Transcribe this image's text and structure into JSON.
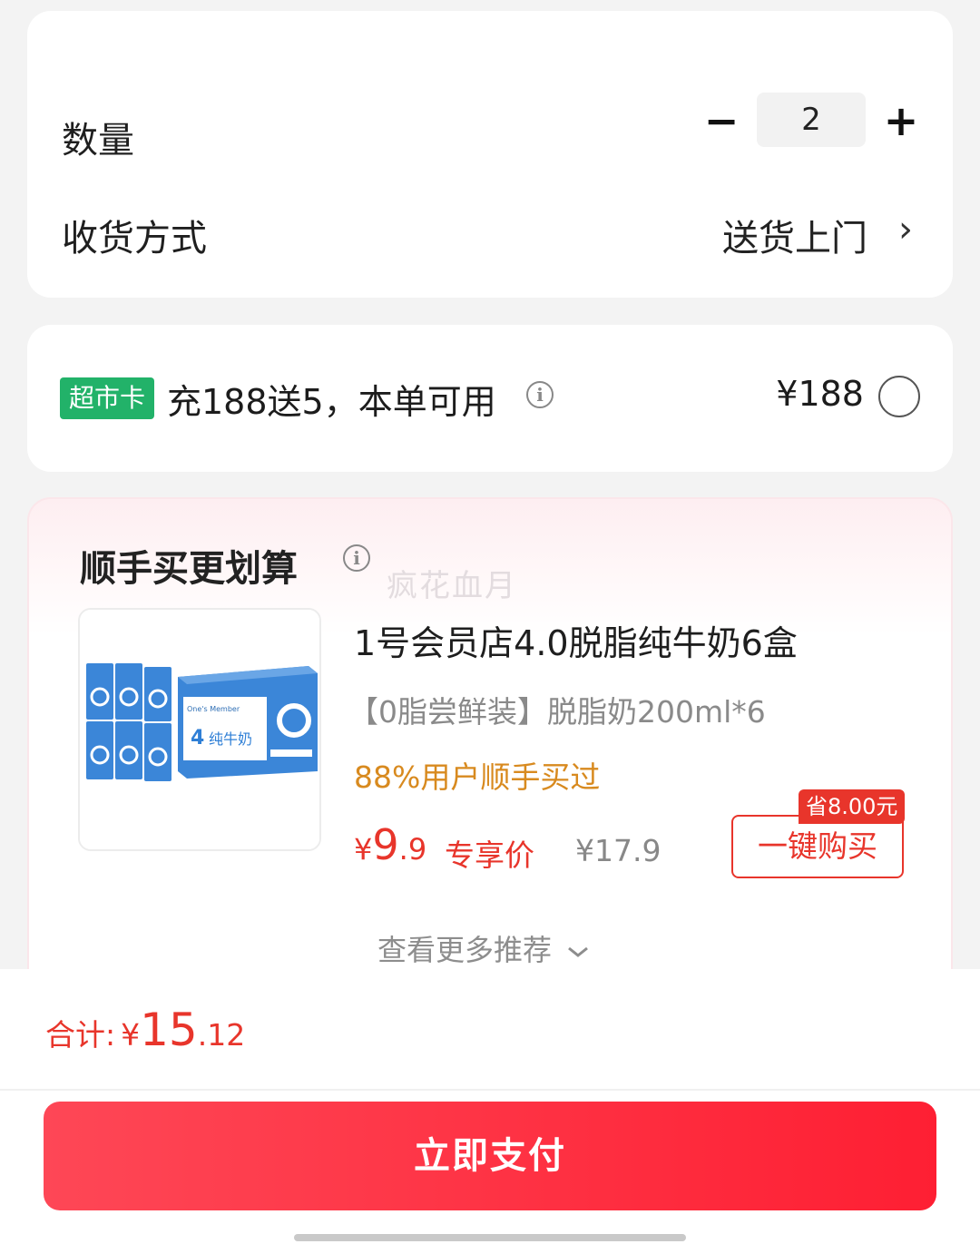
{
  "order": {
    "quantity_label": "数量",
    "quantity_minus": "−",
    "quantity_value": "2",
    "quantity_plus": "+",
    "shipping_label": "收货方式",
    "shipping_value": "送货上门",
    "chevron": "›"
  },
  "supermarket_card": {
    "tag": "超市卡",
    "promo_text": "充188送5，本单可用",
    "price": "¥188",
    "info_icon": "info-icon",
    "selected": false
  },
  "recommend": {
    "title": "顺手买更划算",
    "watermark": "疯花血月",
    "product": {
      "title": "1号会员店4.0脱脂纯牛奶6盒",
      "spec": "【0脂尝鲜装】脱脂奶200ml*6",
      "social_proof": "88%用户顺手买过",
      "price_symbol": "¥",
      "price_int": "9",
      "price_dec": ".9",
      "price_label": "专享价",
      "original_price": "¥17.9",
      "save_badge": "省8.00元",
      "buy_label": "一键购买",
      "image_text": "纯牛奶",
      "image_brand": "One's Member"
    },
    "more_label": "查看更多推荐"
  },
  "footer": {
    "total_label": "合计:",
    "total_symbol": "¥",
    "total_int": "15",
    "total_dec": ".12",
    "pay_label": "立即支付"
  },
  "colors": {
    "accent_red": "#e8352b",
    "pay_gradient_start": "#fe4756",
    "pay_gradient_end": "#fe1f33",
    "tag_green": "#22b269",
    "social_orange": "#d88a1f",
    "milk_blue": "#2f7fd6"
  }
}
